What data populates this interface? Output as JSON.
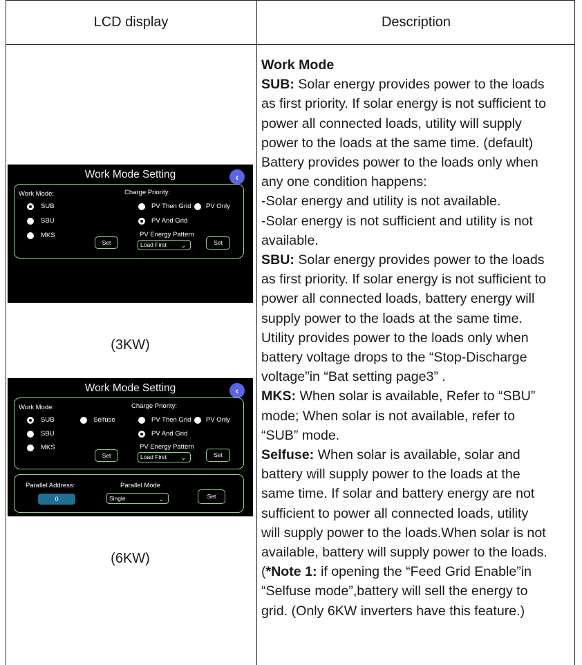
{
  "table": {
    "col1_header": "LCD display",
    "col2_header": "Description"
  },
  "lcd_3kw": {
    "title": "Work Mode Setting",
    "work_mode_label": "Work Mode:",
    "charge_priority_label": "Charge Priority:",
    "modes": [
      "SUB",
      "SBU",
      "MKS"
    ],
    "selected_mode": "SUB",
    "charge_options": [
      "PV Then Grid",
      "PV Only",
      "PV And Grid"
    ],
    "selected_charge": "PV And Grid",
    "set_label": "Set",
    "pv_energy_label": "PV Energy Pattern",
    "pv_energy_value": "Load First",
    "caption": "(3KW)"
  },
  "lcd_6kw": {
    "title": "Work Mode Setting",
    "work_mode_label": "Work Mode:",
    "charge_priority_label": "Charge Priority:",
    "modes": [
      "SUB",
      "SBU",
      "MKS"
    ],
    "selfuse_label": "Selfuse",
    "selected_mode": "SUB",
    "charge_options": [
      "PV Then Grid",
      "PV Only",
      "PV And Grid"
    ],
    "selected_charge": "PV And Grid",
    "set_label": "Set",
    "pv_energy_label": "PV Energy Pattern",
    "pv_energy_value": "Load First",
    "parallel_address_label": "Parallel Address:",
    "parallel_address_value": "0",
    "parallel_mode_label": "Parallel Mode",
    "parallel_mode_value": "Single",
    "caption": "(6KW)"
  },
  "description": {
    "heading": "Work Mode",
    "sub_term": "SUB:",
    "sub_l1": " Solar energy provides power to the loads",
    "sub_l2": "as first priority. If solar energy is not sufficient to",
    "sub_l3": "power all connected loads, utility will supply",
    "sub_l4": "power to the loads at the same time. (default)",
    "sub_l5": "Battery provides power to the loads only when",
    "sub_l6": "any one condition happens:",
    "sub_l7": "-Solar energy and utility is not available.",
    "sub_l8": "-Solar energy is not sufficient and utility is not",
    "sub_l9": "available.",
    "sbu_term": "SBU:",
    "sbu_l1": " Solar energy provides power to the loads",
    "sbu_l2": "as first priority. If solar energy is not sufficient to",
    "sbu_l3": "power all connected loads, battery energy will",
    "sbu_l4": "supply power to the loads at the same time.",
    "sbu_l5": "Utility provides power to the loads only when",
    "sbu_l6": "battery voltage drops to the “Stop-Discharge",
    "sbu_l7": "voltage”in “Bat setting page3” .",
    "mks_term": "MKS:",
    "mks_l1": " When solar is available, Refer to “SBU”",
    "mks_l2": "mode; When solar is  not available, refer to",
    "mks_l3": "“SUB” mode.",
    "selfuse_term": "Selfuse:",
    "selfuse_l1": " When solar is available, solar and",
    "selfuse_l2": "battery will supply power to the loads at the",
    "selfuse_l3": "same time. If solar and battery energy are not",
    "selfuse_l4": "sufficient to power all connected loads, utility",
    "selfuse_l5": "will supply power to the loads.When solar is not",
    "selfuse_l6": "available, battery will supply power to the loads.",
    "note_open": "(",
    "note_term": "*Note 1:",
    "note_l1": " if opening the “Feed Grid Enable”in",
    "note_l2": "“Selfuse mode”,battery will sell the energy to",
    "note_l3": "grid. (Only 6KW inverters have this feature.)"
  },
  "colors": {
    "lcd_background": "#000000",
    "panel_border": "#8fd48a",
    "back_button": "#5b63e6",
    "address_field": "#1e6f93"
  },
  "icons": [
    "back-arrow-icon",
    "chevron-down-icon"
  ]
}
